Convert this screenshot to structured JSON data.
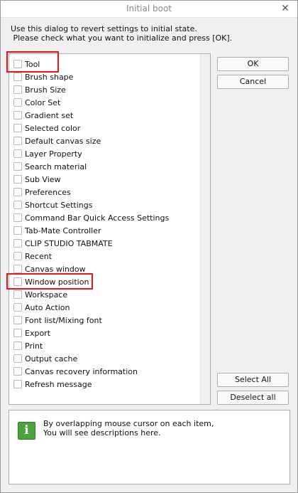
{
  "window": {
    "title": "Initial boot",
    "close_glyph": "✕"
  },
  "instructions": {
    "line1": "Use this dialog to revert settings to initial state.",
    "line2": " Please check what you want to initialize and press [OK]."
  },
  "items": [
    {
      "label": "Tool",
      "checked": false,
      "highlighted": true
    },
    {
      "label": "Brush shape",
      "checked": false
    },
    {
      "label": "Brush Size",
      "checked": false
    },
    {
      "label": "Color Set",
      "checked": false
    },
    {
      "label": "Gradient set",
      "checked": false
    },
    {
      "label": "Selected color",
      "checked": false
    },
    {
      "label": "Default canvas size",
      "checked": false
    },
    {
      "label": "Layer Property",
      "checked": false
    },
    {
      "label": "Search material",
      "checked": false
    },
    {
      "label": "Sub View",
      "checked": false
    },
    {
      "label": "Preferences",
      "checked": false
    },
    {
      "label": "Shortcut Settings",
      "checked": false
    },
    {
      "label": "Command Bar Quick Access Settings",
      "checked": false
    },
    {
      "label": "Tab-Mate Controller",
      "checked": false
    },
    {
      "label": "CLIP STUDIO TABMATE",
      "checked": false
    },
    {
      "label": "Recent",
      "checked": false
    },
    {
      "label": "Canvas window",
      "checked": false
    },
    {
      "label": "Window position",
      "checked": false,
      "highlighted": true
    },
    {
      "label": "Workspace",
      "checked": false
    },
    {
      "label": "Auto Action",
      "checked": false
    },
    {
      "label": "Font list/Mixing font",
      "checked": false
    },
    {
      "label": "Export",
      "checked": false
    },
    {
      "label": "Print",
      "checked": false
    },
    {
      "label": "Output cache",
      "checked": false
    },
    {
      "label": "Canvas recovery information",
      "checked": false
    },
    {
      "label": "Refresh message",
      "checked": false
    }
  ],
  "buttons": {
    "ok": "OK",
    "cancel": "Cancel",
    "select_all": "Select All",
    "deselect_all": "Deselect all"
  },
  "description": {
    "icon_glyph": "i",
    "line1": "By overlapping mouse cursor on each item,",
    "line2": "You will see descriptions here."
  },
  "colors": {
    "highlight": "#e8141c",
    "info_icon": "#4ca33e"
  }
}
